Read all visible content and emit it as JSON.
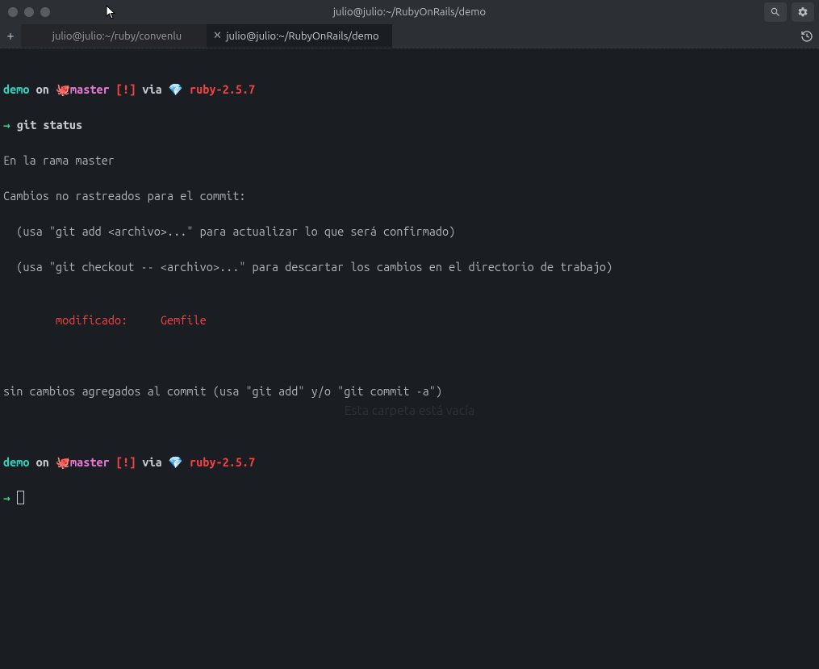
{
  "title": "julio@julio:~/RubyOnRails/demo",
  "tabs": [
    {
      "label": "julio@julio:~/ruby/convenlu",
      "active": false
    },
    {
      "label": "julio@julio:~/RubyOnRails/demo",
      "active": true
    }
  ],
  "newtab_symbol": "+",
  "prompt": {
    "demo": "demo",
    "on": " on ",
    "git_icon": "🐙",
    "branch": "master",
    "dirty": " [!]",
    "via": " via ",
    "gem_icon": "💎 ",
    "ruby": "ruby-2.5.7",
    "arrow": "→ "
  },
  "command1": "git status",
  "output": {
    "line1": "En la rama master",
    "line2": "Cambios no rastreados para el commit:",
    "line3": "  (usa \"git add <archivo>...\" para actualizar lo que será confirmado)",
    "line4": "  (usa \"git checkout -- <archivo>...\" para descartar los cambios en el directorio de trabajo)",
    "blank": "",
    "modif_label": "        modificado:     ",
    "modif_file": "Gemfile",
    "line5": "sin cambios agregados al commit (usa \"git add\" y/o \"git commit -a\")"
  },
  "ghost_text": "Esta carpeta está vacía"
}
